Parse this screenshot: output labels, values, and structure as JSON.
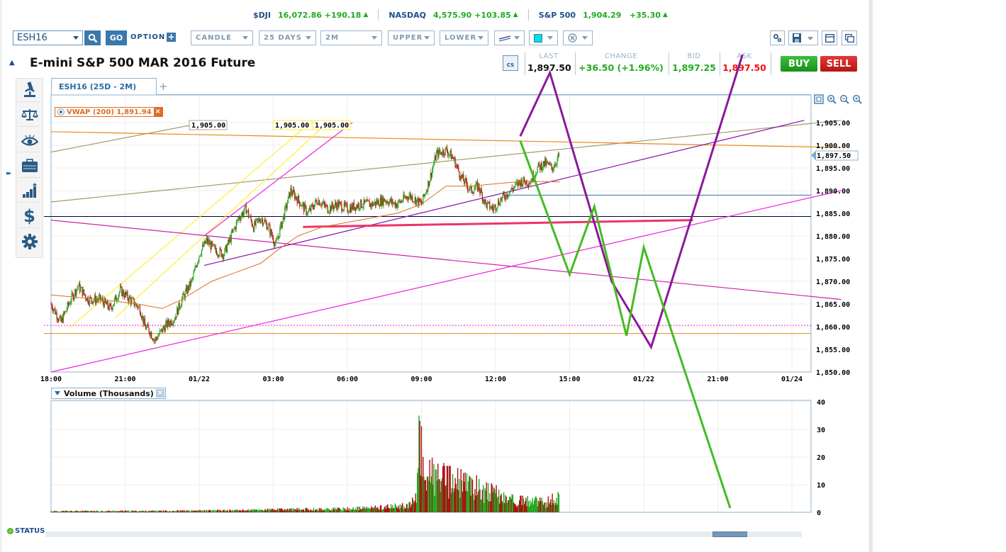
{
  "ticker": [
    {
      "symbol": "$DJI",
      "value": "16,072.86",
      "change": "+190.18",
      "direction": "up"
    },
    {
      "symbol": "NASDAQ",
      "value": "4,575.90",
      "change": "+103.85",
      "direction": "up"
    },
    {
      "symbol": "S&P 500",
      "value": "1,904.29",
      "change": "+35.30",
      "direction": "up"
    }
  ],
  "toolbar": {
    "symbol": "ESH16",
    "search_icon": "search-icon",
    "go_label": "GO",
    "option_label": "OPTION",
    "chart_type": "CANDLE",
    "range": "25 DAYS",
    "interval": "2M",
    "upper": "UPPER",
    "lower": "LOWER",
    "line_style_icon": "draw-line-icon",
    "color_value": "#00e0e0",
    "clear_icon": "clear-drawings-icon",
    "settings_icon": "settings-icon",
    "save_icon": "save-icon",
    "window_icon": "window-icon",
    "popout_icon": "popout-icon"
  },
  "instrument": {
    "title": "E-mini S&P 500 MAR 2016 Future"
  },
  "quote": {
    "cs_label": "CS",
    "last_label": "LAST",
    "last": "1,897.50",
    "change_label": "CHANGE",
    "change": "+36.50 (+1.96%)",
    "bid_label": "BID",
    "bid": "1,897.25",
    "ask_label": "ASK",
    "ask": "1,897.50",
    "buy_label": "BUY",
    "sell_label": "SELL",
    "colors": {
      "up": "#22aa22",
      "down": "#ee1111",
      "buy": "#22a022",
      "sell": "#cc2020"
    }
  },
  "tools": [
    "research-icon",
    "compare-icon",
    "watch-icon",
    "portfolio-icon",
    "studies-icon",
    "trade-icon",
    "settings-gear-icon"
  ],
  "tabs": [
    {
      "label": "ESH16 (25D - 2M)",
      "active": true
    }
  ],
  "add_tab_label": "+",
  "indicator": {
    "label": "VWAP (200) 1,891.94",
    "close": "×"
  },
  "price_flags": [
    "1,905.00",
    "1,905.00",
    "1,905.00"
  ],
  "current_price_tag": "1,897.50",
  "volume_panel": {
    "label": "Volume (Thousands)",
    "close": "×"
  },
  "status_label": "STATUS",
  "chart_data": [
    {
      "type": "candlestick",
      "title": "ESH16 (25D - 2M)",
      "ylim": [
        1850,
        1907
      ],
      "y_ticks": [
        "1,905.00",
        "1,900.00",
        "1,895.00",
        "1,890.00",
        "1,885.00",
        "1,880.00",
        "1,875.00",
        "1,870.00",
        "1,865.00",
        "1,860.00",
        "1,855.00",
        "1,850.00"
      ],
      "y_tick_values": [
        1905,
        1900,
        1895,
        1890,
        1885,
        1880,
        1875,
        1870,
        1865,
        1860,
        1855,
        1850
      ],
      "x_ticks": [
        "18:00",
        "21:00",
        "01/22",
        "03:00",
        "06:00",
        "09:00",
        "12:00",
        "15:00",
        "01/22",
        "21:00",
        "01/24"
      ],
      "x_tick_hours": [
        0,
        3,
        6,
        9,
        12,
        15,
        18,
        21,
        24,
        27,
        30
      ],
      "x_range_hours": [
        0,
        31.5
      ],
      "last_price": 1897.5,
      "price_path": [
        [
          0,
          1865
        ],
        [
          0.4,
          1861
        ],
        [
          0.8,
          1866
        ],
        [
          1.1,
          1869
        ],
        [
          1.5,
          1866
        ],
        [
          2.0,
          1866
        ],
        [
          2.4,
          1864
        ],
        [
          2.8,
          1868
        ],
        [
          3.2,
          1866
        ],
        [
          3.6,
          1864
        ],
        [
          3.8,
          1860
        ],
        [
          4.0,
          1859
        ],
        [
          4.2,
          1857
        ],
        [
          4.6,
          1860
        ],
        [
          5.0,
          1862
        ],
        [
          5.3,
          1866
        ],
        [
          5.7,
          1870
        ],
        [
          6.0,
          1876
        ],
        [
          6.3,
          1879
        ],
        [
          6.6,
          1877
        ],
        [
          7.0,
          1876
        ],
        [
          7.3,
          1880
        ],
        [
          7.6,
          1884
        ],
        [
          7.9,
          1886
        ],
        [
          8.2,
          1882
        ],
        [
          8.5,
          1884
        ],
        [
          8.8,
          1882
        ],
        [
          9.1,
          1878
        ],
        [
          9.4,
          1884
        ],
        [
          9.7,
          1890
        ],
        [
          10.0,
          1888
        ],
        [
          10.4,
          1885
        ],
        [
          10.8,
          1888
        ],
        [
          11.2,
          1886
        ],
        [
          11.6,
          1887
        ],
        [
          12.0,
          1886
        ],
        [
          12.5,
          1887
        ],
        [
          13.0,
          1887
        ],
        [
          13.5,
          1888
        ],
        [
          14.0,
          1887
        ],
        [
          14.5,
          1889
        ],
        [
          15.0,
          1887
        ],
        [
          15.3,
          1892
        ],
        [
          15.6,
          1898
        ],
        [
          16.0,
          1899
        ],
        [
          16.3,
          1897
        ],
        [
          16.6,
          1893
        ],
        [
          17.0,
          1890
        ],
        [
          17.3,
          1891
        ],
        [
          17.6,
          1887
        ],
        [
          17.9,
          1886
        ],
        [
          18.2,
          1888
        ],
        [
          18.6,
          1890
        ],
        [
          19.0,
          1892
        ],
        [
          19.4,
          1892
        ],
        [
          19.7,
          1895
        ],
        [
          20.0,
          1896
        ],
        [
          20.3,
          1895
        ],
        [
          20.6,
          1898
        ]
      ],
      "vwap_path": [
        [
          0,
          1867
        ],
        [
          2,
          1866
        ],
        [
          3.5,
          1865
        ],
        [
          4.5,
          1864
        ],
        [
          5.3,
          1866
        ],
        [
          6.5,
          1870
        ],
        [
          7.5,
          1872
        ],
        [
          8.5,
          1874
        ],
        [
          9.2,
          1877
        ],
        [
          10,
          1880
        ],
        [
          11,
          1882
        ],
        [
          12,
          1883
        ],
        [
          13,
          1884
        ],
        [
          14,
          1885
        ],
        [
          15,
          1887
        ],
        [
          15.5,
          1889
        ],
        [
          16,
          1891
        ],
        [
          17,
          1891
        ],
        [
          18,
          1891.5
        ],
        [
          19,
          1892
        ],
        [
          20,
          1892
        ],
        [
          20.6,
          1891.9
        ]
      ],
      "horizontal_lines": [
        {
          "name": "support-black",
          "price": 1884.3,
          "color": "#000033"
        },
        {
          "name": "blue-line",
          "price": 1889,
          "color": "#3a6fb0"
        },
        {
          "name": "orange-line",
          "price": 1858.5,
          "color": "#e88a1a"
        },
        {
          "name": "magenta-line",
          "price": 1860.3,
          "color": "#ff22cc"
        }
      ],
      "trendlines": [
        {
          "name": "olive-channel-upper",
          "color": "#a09a6a",
          "from": [
            0,
            1898.5
          ],
          "to": [
            6.2,
            1905
          ]
        },
        {
          "name": "olive-channel-lower",
          "color": "#a09a6a",
          "from": [
            0,
            1887.5
          ],
          "to": [
            32,
            1905.5
          ]
        },
        {
          "name": "orange-resistance",
          "color": "#e88a1a",
          "from": [
            0,
            1903
          ],
          "to": [
            32,
            1899.5
          ]
        },
        {
          "name": "yellow-fan-1",
          "color": "#ffee33",
          "from": [
            0.8,
            1860
          ],
          "to": [
            10.5,
            1905
          ]
        },
        {
          "name": "yellow-fan-2",
          "color": "#ffee33",
          "from": [
            2.6,
            1862
          ],
          "to": [
            11.2,
            1905
          ]
        },
        {
          "name": "magenta-fan",
          "color": "#ee22dd",
          "from": [
            6.2,
            1880
          ],
          "to": [
            12.2,
            1905
          ]
        },
        {
          "name": "magenta-descending",
          "color": "#cc22aa",
          "from": [
            0,
            1883.5
          ],
          "to": [
            32,
            1866
          ]
        },
        {
          "name": "magenta-ascending",
          "color": "#ee22dd",
          "from": [
            0,
            1850
          ],
          "to": [
            32,
            1890
          ]
        },
        {
          "name": "purple-ascending",
          "color": "#8811aa",
          "from": [
            6.2,
            1873.5
          ],
          "to": [
            30.5,
            1905.5
          ]
        },
        {
          "name": "pink-support",
          "color": "#ee3366",
          "from": [
            10.2,
            1882
          ],
          "to": [
            26,
            1883.5
          ]
        }
      ],
      "projections": [
        {
          "name": "purple-projection",
          "color": "#8a1a9a",
          "points": [
            [
              19,
              1902
            ],
            [
              20.2,
              1916
            ],
            [
              22.7,
              1870
            ],
            [
              24.3,
              1855.5
            ],
            [
              28,
              1920
            ]
          ]
        },
        {
          "name": "green-projection",
          "color": "#44bb22",
          "points": [
            [
              19,
              1901
            ],
            [
              21,
              1871.5
            ],
            [
              22,
              1886.5
            ],
            [
              23.3,
              1858
            ],
            [
              24,
              1877.5
            ],
            [
              27.5,
              1820
            ]
          ]
        }
      ]
    },
    {
      "type": "bar",
      "title": "Volume (Thousands)",
      "ylim": [
        0,
        40
      ],
      "y_ticks": [
        "40",
        "30",
        "20",
        "10",
        "0"
      ],
      "y_tick_values": [
        40,
        30,
        20,
        10,
        0
      ],
      "description": "Low volume (under ~1K) from 18:00 to ~08:30, spike to ~35K near 08:40, then mostly 5-20K decaying to ~5K by 12:30",
      "envelope": [
        [
          0,
          0.5
        ],
        [
          4,
          0.6
        ],
        [
          7,
          0.8
        ],
        [
          9,
          1.2
        ],
        [
          12,
          1.5
        ],
        [
          13,
          2
        ],
        [
          14.5,
          3
        ],
        [
          14.8,
          6
        ],
        [
          14.9,
          35
        ],
        [
          15.1,
          18
        ],
        [
          15.5,
          16
        ],
        [
          16,
          14
        ],
        [
          16.5,
          13
        ],
        [
          17,
          12
        ],
        [
          17.5,
          10
        ],
        [
          18,
          8
        ],
        [
          18.5,
          6
        ],
        [
          19,
          5
        ],
        [
          19.5,
          5
        ],
        [
          20,
          4
        ],
        [
          20.6,
          7
        ]
      ]
    }
  ]
}
